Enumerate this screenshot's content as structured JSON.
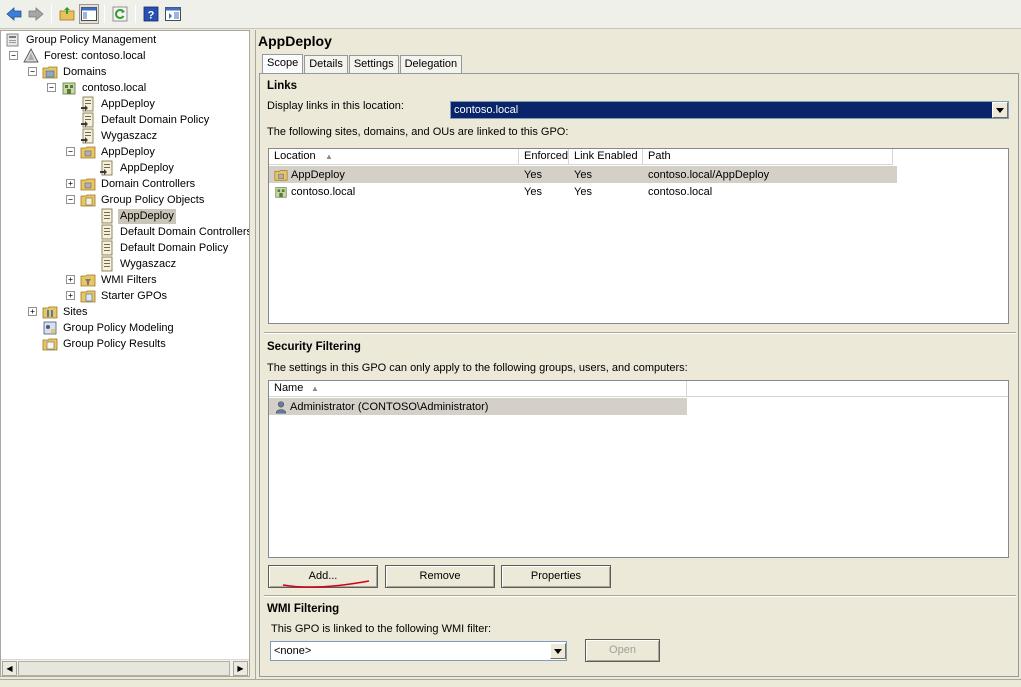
{
  "toolbar": {
    "buttons": [
      "back-icon",
      "forward-icon",
      "up-folder-icon",
      "show-hide-console-tree-icon",
      "refresh-icon",
      "help-icon",
      "properties-pane-icon"
    ]
  },
  "tree": {
    "root": "Group Policy Management",
    "forest": "Forest: contoso.local",
    "domains": "Domains",
    "domain": "contoso.local",
    "link_appdeploy": "AppDeploy",
    "link_default_domain_policy": "Default Domain Policy",
    "link_wygaszacz": "Wygaszacz",
    "ou_appdeploy": "AppDeploy",
    "ou_link_appdeploy": "AppDeploy",
    "domain_controllers": "Domain Controllers",
    "gpo_container": "Group Policy Objects",
    "gpo_appdeploy": "AppDeploy",
    "gpo_default_dc": "Default Domain Controllers",
    "gpo_default_domain": "Default Domain Policy",
    "gpo_wygaszacz": "Wygaszacz",
    "wmi_filters": "WMI Filters",
    "starter_gpos": "Starter GPOs",
    "sites": "Sites",
    "modeling": "Group Policy Modeling",
    "results": "Group Policy Results"
  },
  "detail": {
    "title": "AppDeploy",
    "tabs": [
      "Scope",
      "Details",
      "Settings",
      "Delegation"
    ],
    "links": {
      "heading": "Links",
      "display_label": "Display links in this location:",
      "display_value": "contoso.local",
      "description": "The following sites, domains, and OUs are linked to this GPO:",
      "columns": [
        "Location",
        "Enforced",
        "Link Enabled",
        "Path"
      ],
      "rows": [
        {
          "location": "AppDeploy",
          "enforced": "Yes",
          "enabled": "Yes",
          "path": "contoso.local/AppDeploy"
        },
        {
          "location": "contoso.local",
          "enforced": "Yes",
          "enabled": "Yes",
          "path": "contoso.local"
        }
      ]
    },
    "security": {
      "heading": "Security Filtering",
      "description": "The settings in this GPO can only apply to the following groups, users, and computers:",
      "columns": [
        "Name"
      ],
      "rows": [
        "Administrator (CONTOSO\\Administrator)"
      ],
      "add_label": "Add...",
      "remove_label": "Remove",
      "properties_label": "Properties"
    },
    "wmi": {
      "heading": "WMI Filtering",
      "description": "This GPO is linked to the following WMI filter:",
      "value": "<none>",
      "open_label": "Open"
    }
  },
  "colors": {
    "selection": "#0a246a",
    "annotation": "#d0021b"
  }
}
